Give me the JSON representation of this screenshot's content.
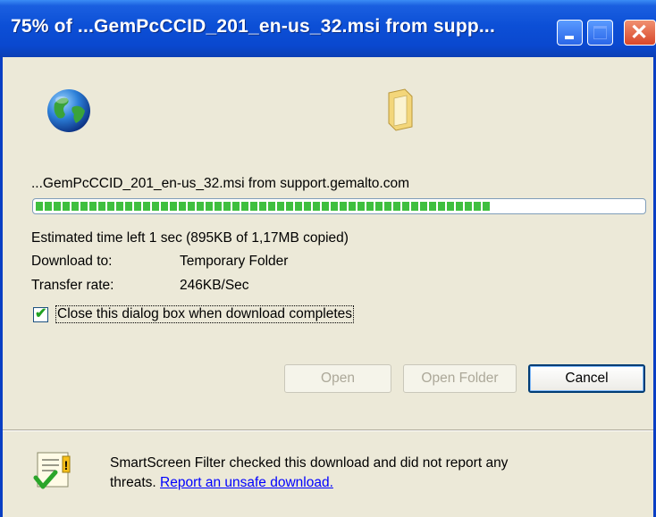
{
  "window": {
    "title": "75% of ...GemPcCCID_201_en-us_32.msi from supp...",
    "controls": {
      "minimize": "minimize-icon",
      "maximize": "maximize-icon",
      "close": "close-icon"
    }
  },
  "download": {
    "source_line": "...GemPcCCID_201_en-us_32.msi from support.gemalto.com",
    "progress_fraction": 0.75,
    "estimated_time": "Estimated time left  1 sec (895KB of 1,17MB copied)",
    "download_to_label": "Download to:",
    "download_to_value": "Temporary Folder",
    "transfer_rate_label": "Transfer rate:",
    "transfer_rate_value": "246KB/Sec",
    "close_when_done_label": "Close this dialog box when download completes",
    "close_when_done_checked": true
  },
  "buttons": {
    "open": "Open",
    "open_folder": "Open Folder",
    "cancel": "Cancel"
  },
  "smartscreen": {
    "line1": "SmartScreen Filter checked this download and did not report any",
    "line2_prefix": "threats.",
    "link": "Report an unsafe download."
  },
  "colors": {
    "titlebar": "#0a48cf",
    "dialog_bg": "#ece9d8",
    "progress_green": "#3fbf3f",
    "link": "#0000ff"
  }
}
